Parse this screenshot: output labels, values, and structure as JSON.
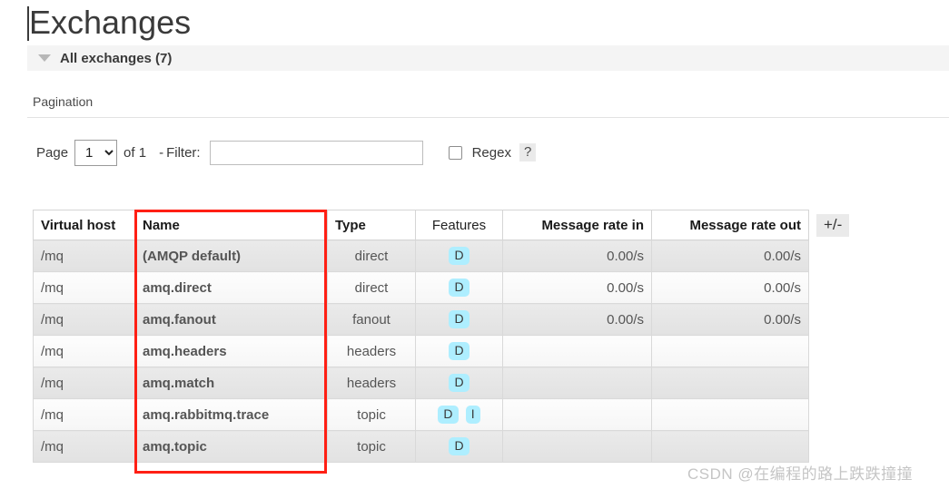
{
  "header": {
    "title": "Exchanges",
    "section_label": "All exchanges (7)",
    "collapse_icon": "triangle-down-icon"
  },
  "pagination": {
    "label": "Pagination",
    "page_label": "Page",
    "page_value": "1",
    "page_options": [
      "1"
    ],
    "of_label": "of 1",
    "dash": "-",
    "filter_label": "Filter:",
    "filter_value": "",
    "filter_placeholder": "",
    "regex_label": "Regex",
    "regex_checked": false,
    "help_label": "?"
  },
  "table": {
    "columns": [
      "Virtual host",
      "Name",
      "Type",
      "Features",
      "Message rate in",
      "Message rate out"
    ],
    "toggle_columns_label": "+/-",
    "rows": [
      {
        "vhost": "/mq",
        "name": "(AMQP default)",
        "type": "direct",
        "features": [
          "D"
        ],
        "rate_in": "0.00/s",
        "rate_out": "0.00/s"
      },
      {
        "vhost": "/mq",
        "name": "amq.direct",
        "type": "direct",
        "features": [
          "D"
        ],
        "rate_in": "0.00/s",
        "rate_out": "0.00/s"
      },
      {
        "vhost": "/mq",
        "name": "amq.fanout",
        "type": "fanout",
        "features": [
          "D"
        ],
        "rate_in": "0.00/s",
        "rate_out": "0.00/s"
      },
      {
        "vhost": "/mq",
        "name": "amq.headers",
        "type": "headers",
        "features": [
          "D"
        ],
        "rate_in": "",
        "rate_out": ""
      },
      {
        "vhost": "/mq",
        "name": "amq.match",
        "type": "headers",
        "features": [
          "D"
        ],
        "rate_in": "",
        "rate_out": ""
      },
      {
        "vhost": "/mq",
        "name": "amq.rabbitmq.trace",
        "type": "topic",
        "features": [
          "D",
          "I"
        ],
        "rate_in": "",
        "rate_out": ""
      },
      {
        "vhost": "/mq",
        "name": "amq.topic",
        "type": "topic",
        "features": [
          "D"
        ],
        "rate_in": "",
        "rate_out": ""
      }
    ]
  },
  "annotation": {
    "color": "#ff1f14",
    "target_column": "Name"
  },
  "watermark": {
    "text": "CSDN @在编程的路上跌跌撞撞"
  },
  "colors": {
    "badge_bg": "#aeeeff",
    "section_bg": "#f4f4f4",
    "annotation": "#ff1f14"
  }
}
